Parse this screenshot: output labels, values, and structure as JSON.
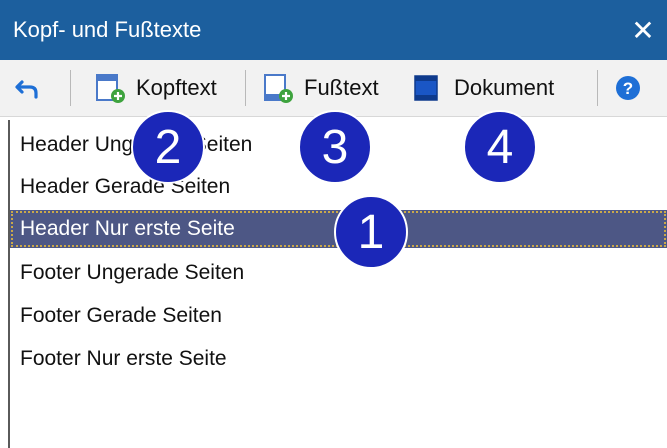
{
  "window": {
    "title": "Kopf- und Fußtexte",
    "close_glyph": "✕"
  },
  "toolbar": {
    "undo_icon": "undo-arrow-icon",
    "kopftext_label": "Kopftext",
    "fusstext_label": "Fußtext",
    "dokument_label": "Dokument",
    "help_glyph": "?"
  },
  "list": {
    "items": [
      {
        "label": "Header Ungerade Seiten"
      },
      {
        "label": "Header Gerade Seiten"
      },
      {
        "label": "Header Nur erste Seite",
        "selected": true
      },
      {
        "label": "Footer Ungerade Seiten"
      },
      {
        "label": "Footer Gerade Seiten"
      },
      {
        "label": "Footer Nur erste Seite"
      }
    ]
  },
  "callouts": [
    "1",
    "2",
    "3",
    "4"
  ],
  "colors": {
    "titlebar": "#1c5f9e",
    "selection": "#4d5785",
    "callout": "#1b27b8",
    "help": "#1e6fd6"
  }
}
